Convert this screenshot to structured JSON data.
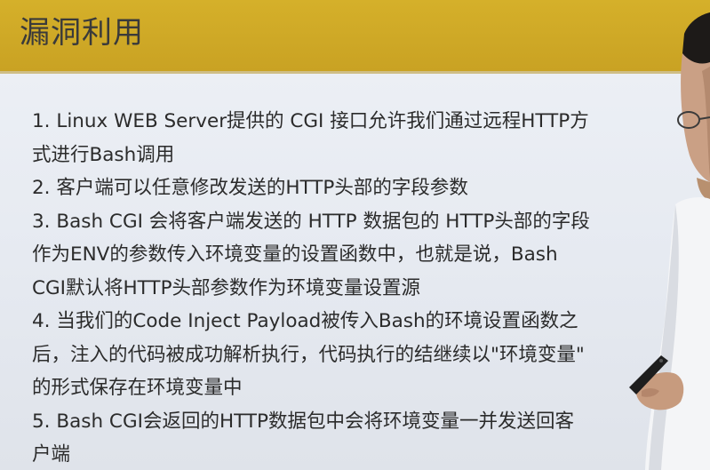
{
  "slide": {
    "title": "漏洞利用",
    "lines": [
      "1. Linux WEB Server提供的 CGI 接口允许我们通过远程HTTP方",
      "式进行Bash调用",
      "2. 客户端可以任意修改发送的HTTP头部的字段参数",
      "3. Bash CGI 会将客户端发送的 HTTP 数据包的 HTTP头部的字段",
      "作为ENV的参数传入环境变量的设置函数中，也就是说，Bash",
      "CGI默认将HTTP头部参数作为环境变量设置源",
      "4. 当我们的Code Inject Payload被传入Bash的环境设置函数之",
      "后，注入的代码被成功解析执行，代码执行的结继续以\"环境变量\"",
      "的形式保存在环境变量中",
      "5. Bash CGI会返回的HTTP数据包中会将环境变量一并发送回客",
      "户端"
    ]
  },
  "colors": {
    "header": "#d5b02a",
    "background": "#e9edf3",
    "text": "#2b2b2b"
  }
}
